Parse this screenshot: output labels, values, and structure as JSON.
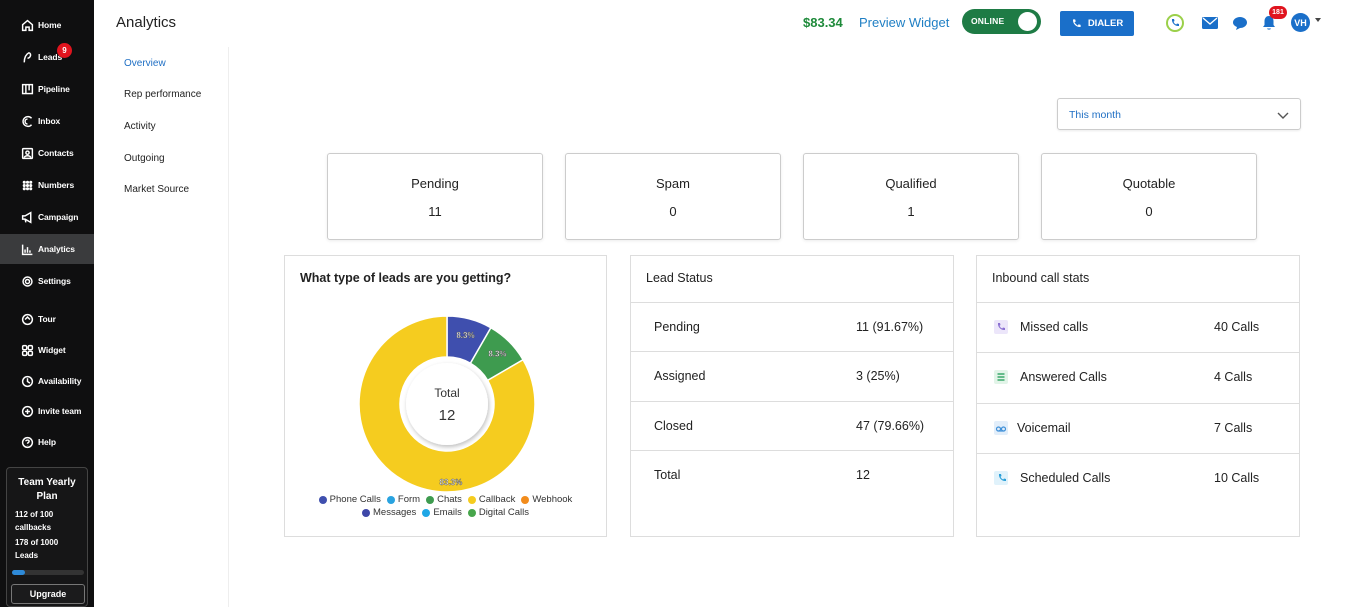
{
  "sidebar": {
    "items": [
      {
        "label": "Home",
        "icon": "home-icon"
      },
      {
        "label": "Leads",
        "icon": "leads-icon",
        "badge": "9"
      },
      {
        "label": "Pipeline",
        "icon": "pipeline-icon"
      },
      {
        "label": "Inbox",
        "icon": "inbox-icon"
      },
      {
        "label": "Contacts",
        "icon": "contacts-icon"
      },
      {
        "label": "Numbers",
        "icon": "numbers-icon"
      },
      {
        "label": "Campaign",
        "icon": "megaphone-icon"
      },
      {
        "label": "Analytics",
        "icon": "analytics-icon",
        "active": true
      },
      {
        "label": "Settings",
        "icon": "gear-icon"
      },
      {
        "label": "Tour",
        "icon": "tour-icon"
      },
      {
        "label": "Widget",
        "icon": "widget-icon"
      },
      {
        "label": "Availability",
        "icon": "clock-icon"
      },
      {
        "label": "Invite team",
        "icon": "plus-circle-icon"
      },
      {
        "label": "Help",
        "icon": "help-icon"
      }
    ],
    "plan": {
      "title": "Team Yearly Plan",
      "callbacks": "112 of 100 callbacks",
      "leads": "178 of 1000 Leads",
      "usage_fraction": 0.18,
      "upgrade_label": "Upgrade"
    }
  },
  "header": {
    "title": "Analytics",
    "balance": "$83.34",
    "preview_widget": "Preview Widget",
    "status_toggle": "ONLINE",
    "dialer_label": "DIALER",
    "notification_count": "181",
    "avatar_initials": "VH"
  },
  "subnav": {
    "items": [
      "Overview",
      "Rep performance",
      "Activity",
      "Outgoing",
      "Market Source"
    ],
    "active": "Overview"
  },
  "filter": {
    "period": "This month"
  },
  "stats": [
    {
      "label": "Pending",
      "value": "11"
    },
    {
      "label": "Spam",
      "value": "0"
    },
    {
      "label": "Qualified",
      "value": "1"
    },
    {
      "label": "Quotable",
      "value": "0"
    }
  ],
  "lead_types": {
    "title": "What type of leads are you getting?",
    "center_label": "Total",
    "center_value": "12"
  },
  "lead_status": {
    "title": "Lead Status",
    "rows": [
      {
        "label": "Pending",
        "value": "11 (91.67%)"
      },
      {
        "label": "Assigned",
        "value": "3 (25%)"
      },
      {
        "label": "Closed",
        "value": "47 (79.66%)"
      },
      {
        "label": "Total",
        "value": "12"
      }
    ]
  },
  "inbound_calls": {
    "title": "Inbound call stats",
    "rows": [
      {
        "label": "Missed calls",
        "value": "40 Calls",
        "icon": "missed-call-icon",
        "color": "#8a6fd1"
      },
      {
        "label": "Answered Calls",
        "value": "4 Calls",
        "icon": "answered-call-icon",
        "color": "#3aa86b"
      },
      {
        "label": "Voicemail",
        "value": "7 Calls",
        "icon": "voicemail-icon",
        "color": "#3d8fd8"
      },
      {
        "label": "Scheduled Calls",
        "value": "10 Calls",
        "icon": "scheduled-call-icon",
        "color": "#2a9fd8"
      }
    ]
  },
  "chart_data": {
    "type": "pie",
    "donut": true,
    "categories": [
      "Phone Calls",
      "Form",
      "Chats",
      "Callback",
      "Webhook",
      "Messages",
      "Emails",
      "Digital Calls"
    ],
    "values": [
      8.3,
      0,
      8.3,
      83.3,
      0,
      0,
      0,
      0
    ],
    "slice_labels": [
      "8.3%",
      "",
      "8.3%",
      "83.3%",
      "",
      "",
      "",
      ""
    ],
    "colors": [
      "#3f4fae",
      "#29a3e0",
      "#3e9b4f",
      "#f5cc1f",
      "#f28c1c",
      "#3e47a8",
      "#1fa7e6",
      "#47a64b"
    ],
    "legend_position": "bottom"
  }
}
